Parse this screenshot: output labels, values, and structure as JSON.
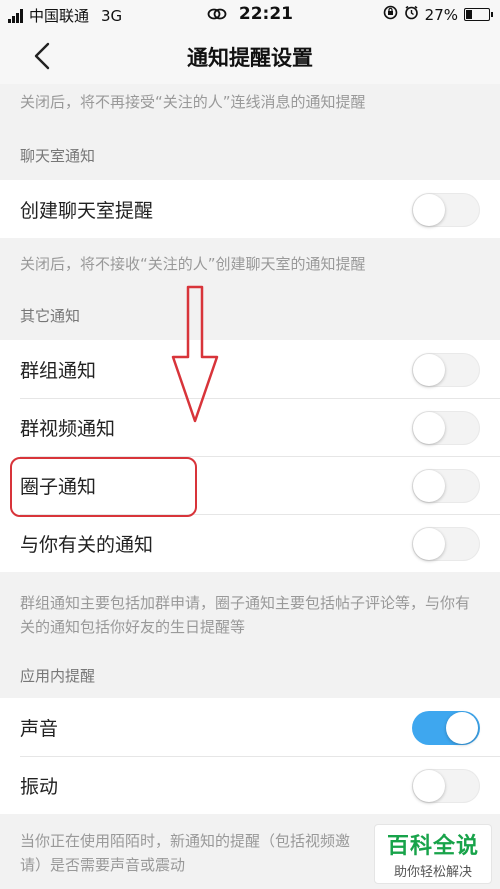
{
  "status_bar": {
    "carrier": "中国联通",
    "network": "3G",
    "time": "22:21",
    "battery_percent": "27%",
    "battery_level": 0.27
  },
  "nav": {
    "title": "通知提醒设置",
    "back_icon": "chevron-left-icon"
  },
  "notes": {
    "followed_live": "关闭后，将不再接受“关注的人”连线消息的通知提醒",
    "chatroom": "关闭后，将不接收“关注的人”创建聊天室的通知提醒",
    "other": "群组通知主要包括加群申请，圈子通知主要包括帖子评论等，与你有关的通知包括你好友的生日提醒等",
    "in_app": "当你正在使用陌陌时，新通知的提醒（包括视频邀请）是否需要声音或震动"
  },
  "sections": {
    "chatroom": "聊天室通知",
    "other": "其它通知",
    "in_app": "应用内提醒"
  },
  "chatroom_items": [
    {
      "label": "创建聊天室提醒",
      "on": false
    }
  ],
  "other_items": [
    {
      "label": "群组通知",
      "on": false
    },
    {
      "label": "群视频通知",
      "on": false
    },
    {
      "label": "圈子通知",
      "on": false
    },
    {
      "label": "与你有关的通知",
      "on": false
    }
  ],
  "in_app_items": [
    {
      "label": "声音",
      "on": true
    },
    {
      "label": "振动",
      "on": false
    }
  ],
  "colors": {
    "toggle_on": "#3ea7ef",
    "annotation_red": "#d8343a",
    "watermark_green": "#18a34a"
  },
  "watermark": {
    "title": "百科全说",
    "subtitle": "助你轻松解决"
  }
}
